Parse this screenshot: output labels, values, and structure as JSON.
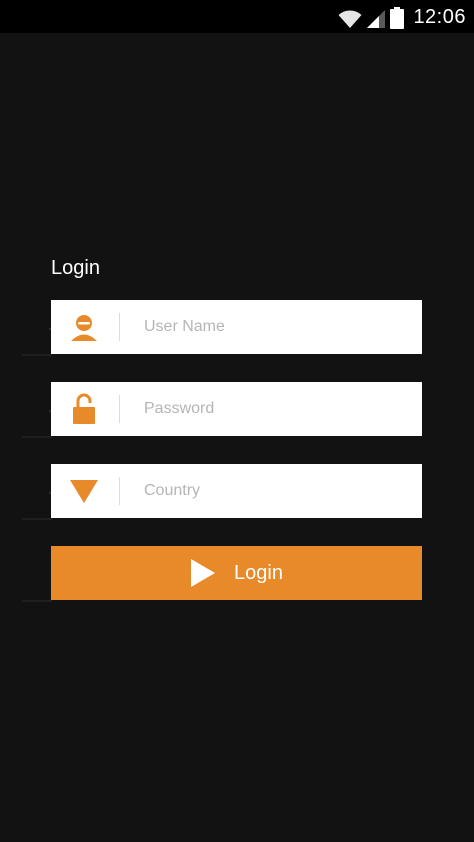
{
  "status_bar": {
    "time": "12:06",
    "icons": [
      "wifi-icon",
      "signal-icon",
      "battery-icon"
    ]
  },
  "login_form": {
    "title": "Login",
    "username": {
      "placeholder": "User Name",
      "value": "",
      "icon": "user-icon"
    },
    "password": {
      "placeholder": "Password",
      "value": "",
      "icon": "lock-icon"
    },
    "country": {
      "placeholder": "Country",
      "value": "",
      "icon": "triangle-down-icon"
    },
    "submit": {
      "label": "Login",
      "icon": "play-icon"
    }
  },
  "colors": {
    "accent": "#e8892a",
    "background": "#121212",
    "status_bar": "#000000",
    "field_background": "#ffffff",
    "placeholder": "#b5b5b5"
  }
}
